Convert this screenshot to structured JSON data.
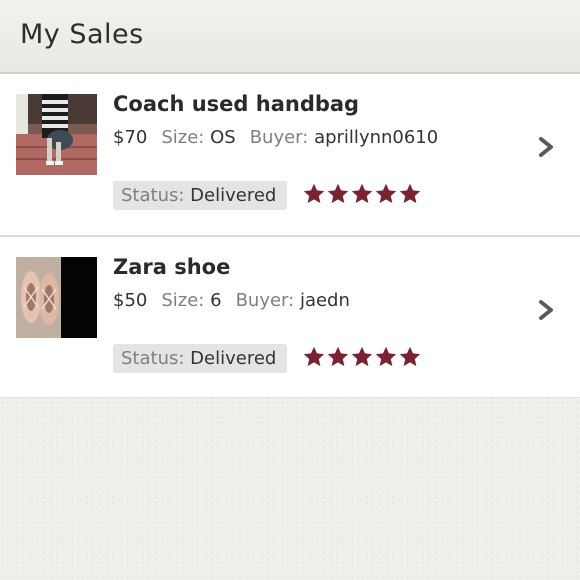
{
  "header": {
    "title": "My Sales"
  },
  "labels": {
    "size": "Size:",
    "buyer": "Buyer:",
    "status": "Status:"
  },
  "sales": [
    {
      "title": "Coach used handbag",
      "price": "$70",
      "size": "OS",
      "buyer": "aprillynn0610",
      "status": "Delivered",
      "rating": 5
    },
    {
      "title": "Zara shoe",
      "price": "$50",
      "size": "6",
      "buyer": "jaedn",
      "status": "Delivered",
      "rating": 5
    }
  ],
  "colors": {
    "star": "#7a2332",
    "chevron": "#5a5a5a",
    "status_bg": "#e4e4e4"
  },
  "icons": {
    "row_arrow": "chevron-right-icon",
    "rating": "star-icon"
  }
}
